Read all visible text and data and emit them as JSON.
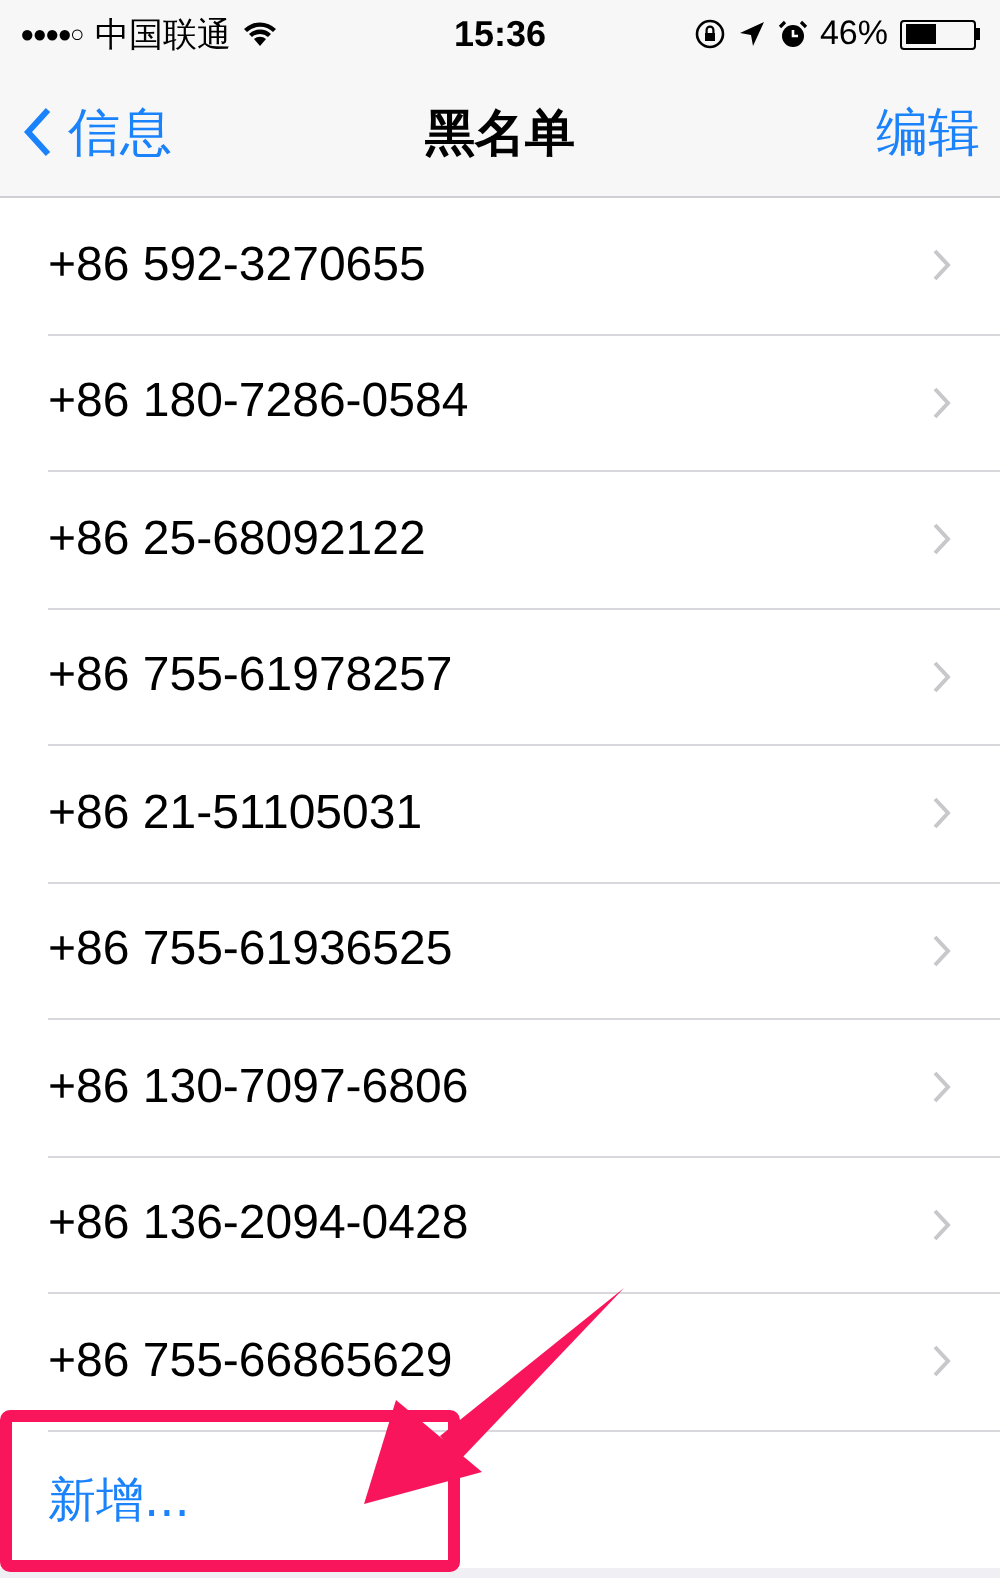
{
  "status_bar": {
    "signal_dots": "●●●●○",
    "carrier": "中国联通",
    "time": "15:36",
    "battery": {
      "text": "46%",
      "level": 0.46
    }
  },
  "nav_bar": {
    "back": "信息",
    "title": "黑名单",
    "action": "编辑"
  },
  "blocked_numbers": [
    {
      "number": "+86 592-3270655"
    },
    {
      "number": "+86 180-7286-0584"
    },
    {
      "number": "+86 25-68092122"
    },
    {
      "number": "+86 755-61978257"
    },
    {
      "number": "+86 21-51105031"
    },
    {
      "number": "+86 755-61936525"
    },
    {
      "number": "+86 130-7097-6806"
    },
    {
      "number": "+86 136-2094-0428"
    },
    {
      "number": "+86 755-66865629"
    }
  ],
  "add_new": "新增..."
}
